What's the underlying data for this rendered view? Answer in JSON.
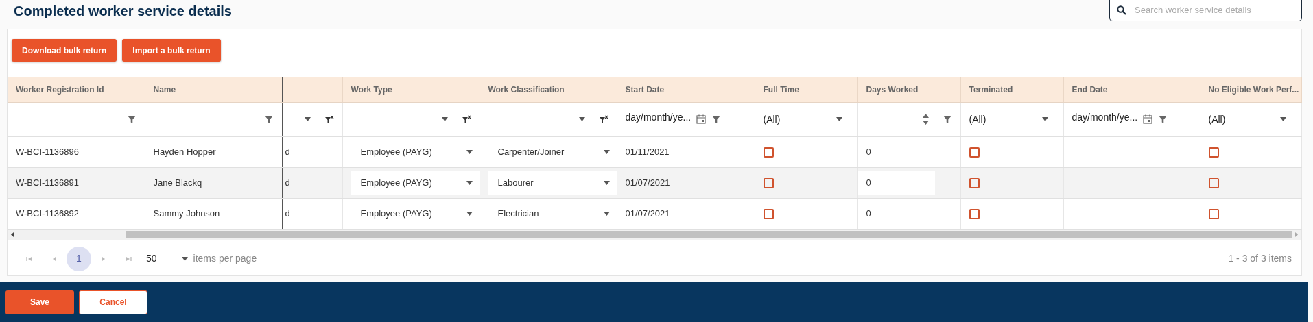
{
  "page": {
    "title": "Completed worker service details"
  },
  "search": {
    "placeholder": "Search worker service details"
  },
  "toolbar": {
    "buttons": [
      "Download bulk return",
      "Import a bulk return"
    ]
  },
  "table": {
    "columns": [
      {
        "header": "Worker Registration Id",
        "filter": {
          "kind": "text"
        }
      },
      {
        "header": "Name",
        "filter": {
          "kind": "text"
        }
      },
      {
        "filter": {
          "kind": "dropdown"
        }
      },
      {
        "header": "Work Type",
        "filter": {
          "kind": "dropdown"
        }
      },
      {
        "header": "Work Classification",
        "filter": {
          "kind": "dropdown"
        }
      },
      {
        "header": "Start Date",
        "filter": {
          "kind": "date",
          "placeholder": "day/month/ye..."
        }
      },
      {
        "header": "Full Time",
        "filter": {
          "kind": "select",
          "value": "(All)"
        }
      },
      {
        "header": "Days Worked",
        "filter": {
          "kind": "number"
        }
      },
      {
        "header": "Terminated",
        "filter": {
          "kind": "select",
          "value": "(All)"
        }
      },
      {
        "header": "End Date",
        "filter": {
          "kind": "date",
          "placeholder": "day/month/ye..."
        }
      },
      {
        "header": "No Eligible Work Perf...",
        "filter": {
          "kind": "select",
          "value": "(All)"
        }
      }
    ],
    "rows": [
      {
        "selected": false,
        "cells": [
          {
            "kind": "text",
            "text": "W-BCI-1136896"
          },
          {
            "kind": "text",
            "text": "Hayden Hopper"
          },
          {
            "kind": "clipped",
            "text": "d"
          },
          {
            "kind": "dropdown",
            "value": "Employee (PAYG)"
          },
          {
            "kind": "dropdown",
            "value": "Carpenter/Joiner"
          },
          {
            "kind": "text",
            "text": "01/11/2021"
          },
          {
            "kind": "checkbox",
            "checked": false
          },
          {
            "kind": "number",
            "value": "0"
          },
          {
            "kind": "checkbox",
            "checked": false
          },
          {
            "kind": "empty"
          },
          {
            "kind": "checkbox",
            "checked": false
          }
        ]
      },
      {
        "selected": true,
        "cells": [
          {
            "kind": "text",
            "text": "W-BCI-1136891"
          },
          {
            "kind": "text",
            "text": "Jane Blackq"
          },
          {
            "kind": "clipped",
            "text": "d"
          },
          {
            "kind": "dropdown",
            "value": "Employee (PAYG)"
          },
          {
            "kind": "dropdown",
            "value": "Labourer"
          },
          {
            "kind": "text",
            "text": "01/07/2021"
          },
          {
            "kind": "checkbox",
            "checked": false
          },
          {
            "kind": "number",
            "value": "0"
          },
          {
            "kind": "checkbox",
            "checked": false
          },
          {
            "kind": "empty"
          },
          {
            "kind": "checkbox",
            "checked": false
          }
        ]
      },
      {
        "selected": false,
        "cells": [
          {
            "kind": "text",
            "text": "W-BCI-1136892"
          },
          {
            "kind": "text",
            "text": "Sammy Johnson"
          },
          {
            "kind": "clipped",
            "text": "d"
          },
          {
            "kind": "dropdown",
            "value": "Employee (PAYG)"
          },
          {
            "kind": "dropdown",
            "value": "Electrician"
          },
          {
            "kind": "text",
            "text": "01/07/2021"
          },
          {
            "kind": "checkbox",
            "checked": false
          },
          {
            "kind": "number",
            "value": "0"
          },
          {
            "kind": "checkbox",
            "checked": false
          },
          {
            "kind": "empty"
          },
          {
            "kind": "checkbox",
            "checked": false
          }
        ]
      }
    ]
  },
  "pager": {
    "pages": [
      {
        "label": "1",
        "selected": true
      }
    ],
    "page_size": "50",
    "page_size_label": "items per page",
    "summary": "1 - 3 of 3 items"
  },
  "footer": {
    "buttons": [
      {
        "label": "Save",
        "kind": "primary"
      },
      {
        "label": "Cancel",
        "kind": "secondary"
      }
    ]
  }
}
